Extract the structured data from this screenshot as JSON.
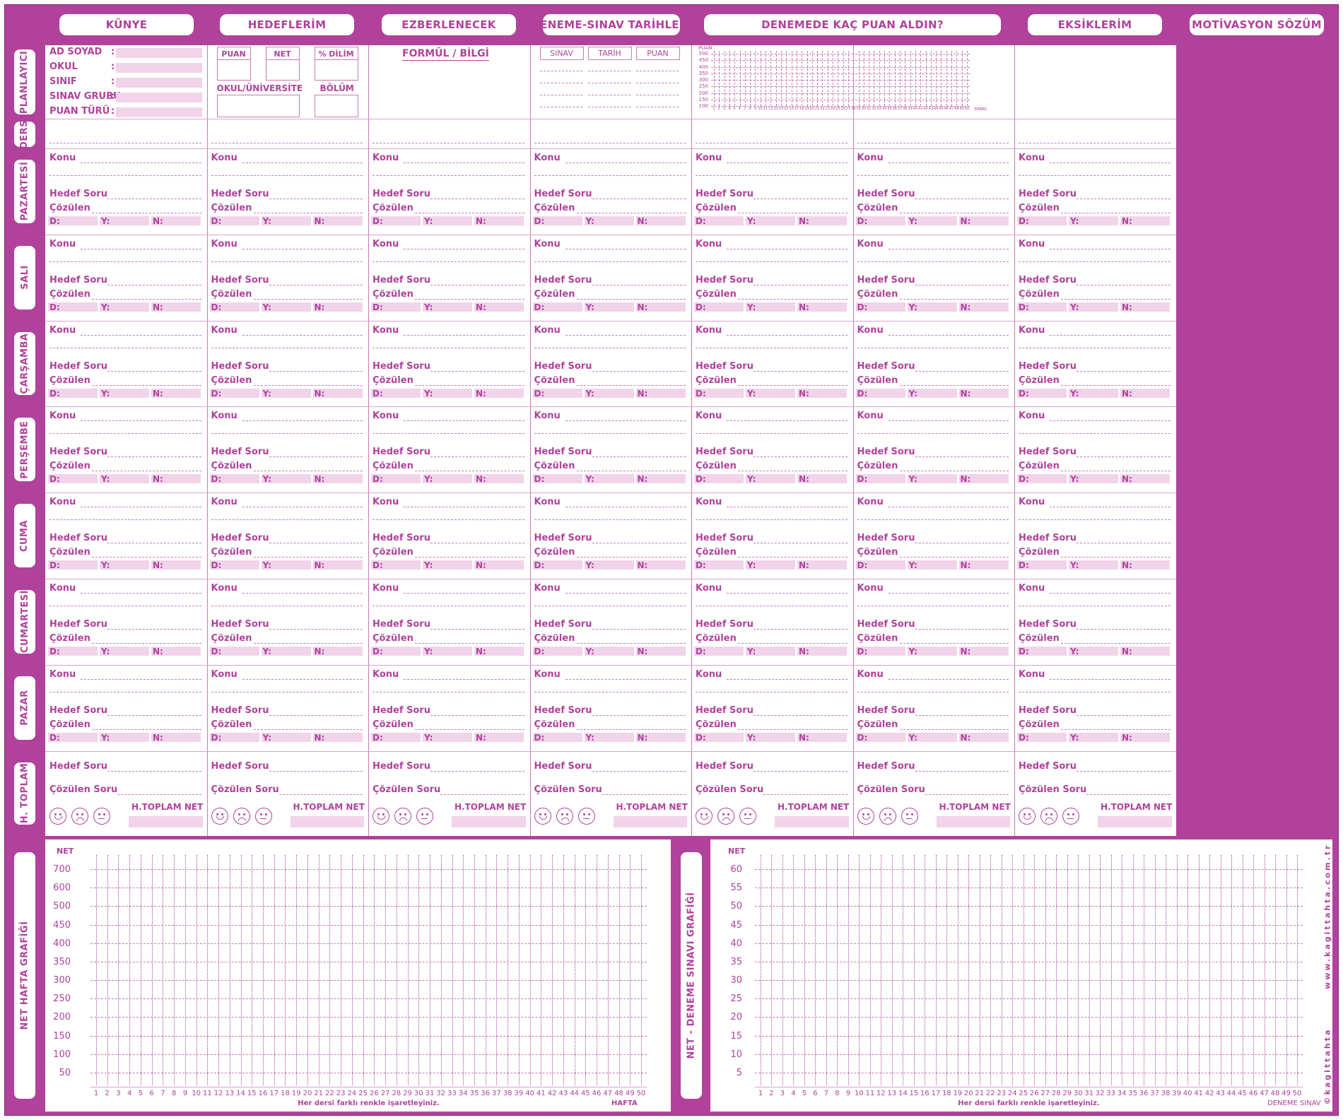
{
  "columns": [
    "KÜNYE",
    "HEDEFLERİM",
    "EZBERLENECEK",
    "DENEME-SINAV TARİHLERİ",
    "DENEMEDE KAÇ PUAN ALDIN?",
    "EKSİKLERİM",
    "MOTİVASYON SÖZÜM"
  ],
  "row_labels": {
    "planlayici": "PLANLAYICI",
    "ders": "DERS",
    "days": [
      "PAZARTESİ",
      "SALI",
      "ÇARŞAMBA",
      "PERŞEMBE",
      "CUMA",
      "CUMARTESİ",
      "PAZAR"
    ],
    "toplam": "H. TOPLAM"
  },
  "kunye_fields": [
    "AD SOYAD",
    "OKUL",
    "SINIF",
    "SINAV GRUBU",
    "PUAN TÜRÜ"
  ],
  "kunye_colon": ":",
  "hedef": {
    "puan": "PUAN",
    "net": "NET",
    "dilim": "% DİLİM",
    "okul": "OKUL/ÜNİVERSİTE",
    "bolum": "BÖLÜM"
  },
  "ezber_label": "FORMÜL  /  BİLGİ",
  "deneme_headers": [
    "SINAV",
    "TARİH",
    "PUAN"
  ],
  "mini_chart": {
    "ylabel": "PUAN",
    "yticks": [
      "500",
      "450",
      "400",
      "350",
      "300",
      "250",
      "200",
      "150",
      "100"
    ],
    "xlabel": "SINAV",
    "xcount": 50
  },
  "day_cell": {
    "konu": "Konu",
    "hedef": "Hedef Soru",
    "cozulen": "Çözülen",
    "d": "D:",
    "y": "Y:",
    "n": "N:"
  },
  "total_cell": {
    "hedef": "Hedef Soru",
    "cozulen": "Çözülen Soru",
    "net": "H.TOPLAM NET"
  },
  "weekly_chart": {
    "title": "NET HAFTA GRAFİĞİ",
    "ylabel": "NET",
    "yticks": [
      "700",
      "600",
      "500",
      "450",
      "400",
      "350",
      "300",
      "250",
      "200",
      "150",
      "100",
      "50"
    ],
    "xcount": 50,
    "xlabel": "HAFTA",
    "note": "Her dersi farklı renkle işaretleyiniz."
  },
  "exam_chart": {
    "title": "NET - DENEME SINAVI GRAFİĞİ",
    "ylabel": "NET",
    "yticks": [
      "60",
      "55",
      "50",
      "45",
      "40",
      "35",
      "30",
      "25",
      "20",
      "15",
      "10",
      "5"
    ],
    "xcount": 50,
    "xlabel": "DENEME SINAV",
    "note": "Her dersi farklı renkle işaretleyiniz."
  },
  "brand": "©kagittahta        www.kagittahta.com.tr",
  "colors": {
    "accent": "#b0429c",
    "fill": "#f1d3ea"
  }
}
